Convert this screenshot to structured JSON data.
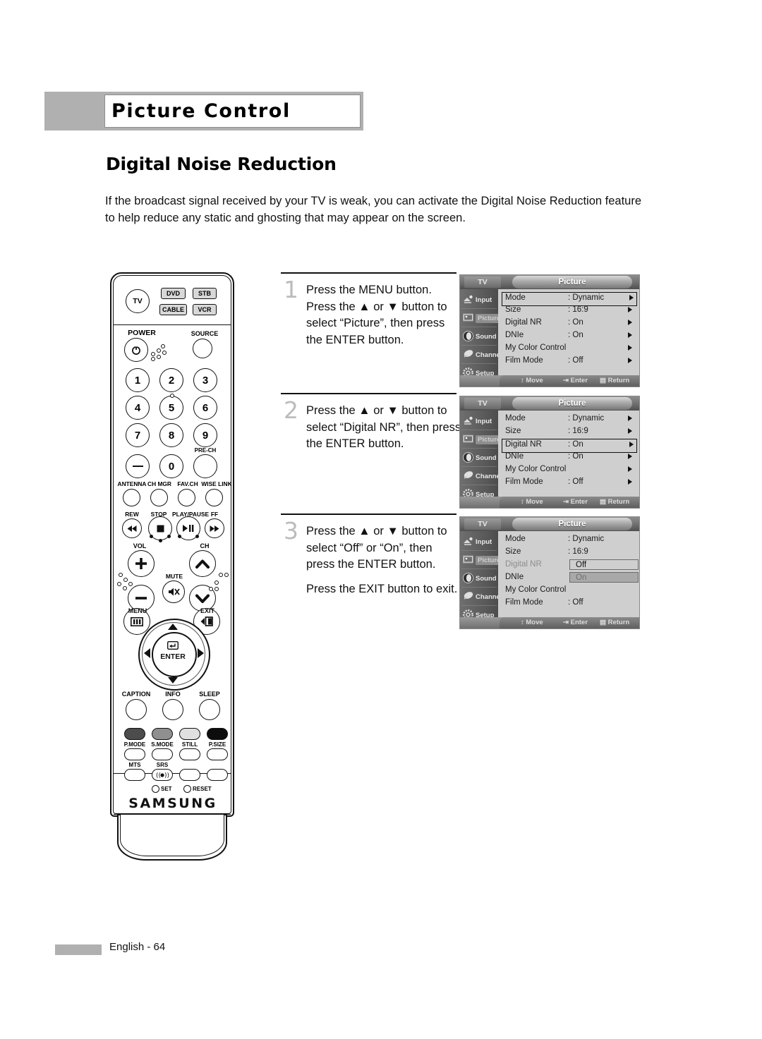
{
  "header": {
    "title": "Picture Control"
  },
  "section": {
    "title": "Digital Noise Reduction"
  },
  "intro": {
    "paragraph": "If the broadcast signal received by your TV is weak, you can activate the Digital Noise Reduction feature to help reduce any static and ghosting that may appear on the screen."
  },
  "footer": {
    "page_label": "English - 64"
  },
  "steps": [
    {
      "number": "1",
      "text": "Press the MENU button. Press the ▲ or ▼ button to select “Picture”, then press the ENTER button.",
      "extra": ""
    },
    {
      "number": "2",
      "text": "Press the ▲ or ▼ button to select “Digital NR”, then press the ENTER button.",
      "extra": ""
    },
    {
      "number": "3",
      "text": "Press the ▲ or ▼ button to select “Off” or “On”, then press the ENTER button.",
      "extra": "Press the EXIT button to exit."
    }
  ],
  "osd": {
    "tv_label": "TV",
    "title": "Picture",
    "sidebar": [
      {
        "label": "Input",
        "icon": "input-jack-icon"
      },
      {
        "label": "Picture",
        "icon": "picture-screen-icon"
      },
      {
        "label": "Sound",
        "icon": "speaker-icon"
      },
      {
        "label": "Channel",
        "icon": "satellite-dish-icon"
      },
      {
        "label": "Setup",
        "icon": "gear-icon"
      }
    ],
    "hints": {
      "move": "Move",
      "enter": "Enter",
      "return": "Return"
    },
    "screens": [
      {
        "rows": [
          {
            "label": "Mode",
            "value": ": Dynamic",
            "arrow": true,
            "selected": true
          },
          {
            "label": "Size",
            "value": ": 16:9",
            "arrow": true,
            "selected": false
          },
          {
            "label": "Digital NR",
            "value": ": On",
            "arrow": true,
            "selected": false
          },
          {
            "label": "DNIe",
            "value": ": On",
            "arrow": true,
            "selected": false
          },
          {
            "label": "My Color Control",
            "value": "",
            "arrow": true,
            "selected": false
          },
          {
            "label": "Film Mode",
            "value": ": Off",
            "arrow": true,
            "selected": false
          }
        ]
      },
      {
        "rows": [
          {
            "label": "Mode",
            "value": ": Dynamic",
            "arrow": true,
            "selected": false
          },
          {
            "label": "Size",
            "value": ": 16:9",
            "arrow": true,
            "selected": false
          },
          {
            "label": "Digital NR",
            "value": ": On",
            "arrow": true,
            "selected": true
          },
          {
            "label": "DNIe",
            "value": ": On",
            "arrow": true,
            "selected": false
          },
          {
            "label": "My Color Control",
            "value": "",
            "arrow": true,
            "selected": false
          },
          {
            "label": "Film Mode",
            "value": ": Off",
            "arrow": true,
            "selected": false
          }
        ]
      },
      {
        "rows": [
          {
            "label": "Mode",
            "value": ": Dynamic",
            "arrow": false,
            "selected": false
          },
          {
            "label": "Size",
            "value": ": 16:9",
            "arrow": false,
            "selected": false
          },
          {
            "label": "Digital NR",
            "value": "",
            "arrow": false,
            "selected": false,
            "dim": true,
            "option": "Off",
            "option_state": "off"
          },
          {
            "label": "DNIe",
            "value": "",
            "arrow": false,
            "selected": false,
            "option": "On",
            "option_state": "on"
          },
          {
            "label": "My Color Control",
            "value": "",
            "arrow": false,
            "selected": false
          },
          {
            "label": "Film Mode",
            "value": ": Off",
            "arrow": false,
            "selected": false
          }
        ]
      }
    ]
  },
  "remote": {
    "brand": "SAMSUNG",
    "device_buttons": [
      "TV",
      "DVD",
      "STB",
      "CABLE",
      "VCR"
    ],
    "power_label": "POWER",
    "source_label": "SOURCE",
    "numbers": [
      "1",
      "2",
      "3",
      "4",
      "5",
      "6",
      "7",
      "8",
      "9",
      "0"
    ],
    "prech_label": "PRE-CH",
    "minus_label": "—",
    "fn_row": [
      "ANTENNA",
      "CH MGR",
      "FAV.CH",
      "WISE LINK"
    ],
    "transport": [
      "REW",
      "STOP",
      "PLAY/PAUSE",
      "FF"
    ],
    "vol_label": "VOL",
    "ch_label": "CH",
    "mute_label": "MUTE",
    "menu_label": "MENU",
    "exit_label": "EXIT",
    "enter_label": "ENTER",
    "bottom_row1": [
      "CAPTION",
      "INFO",
      "SLEEP"
    ],
    "color_keys": [
      "P.MODE",
      "S.MODE",
      "STILL",
      "P.SIZE"
    ],
    "bottom_row3": [
      "MTS",
      "SRS",
      "",
      ""
    ],
    "set_label": "SET",
    "reset_label": "RESET"
  },
  "colors": {
    "header_grey": "#b0b0b0",
    "step_number_grey": "#bcbcbc",
    "osd_body": "#cfcfcf",
    "osd_highlight": "#a9a9a9",
    "ink": "#111111"
  }
}
